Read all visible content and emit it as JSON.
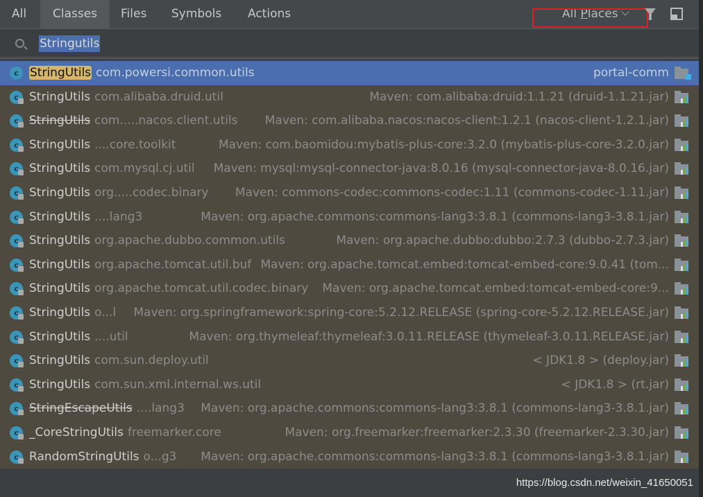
{
  "tabs": [
    {
      "label": "All"
    },
    {
      "label": "Classes",
      "active": true
    },
    {
      "label": "Files"
    },
    {
      "label": "Symbols"
    },
    {
      "label": "Actions"
    }
  ],
  "scope": {
    "label_pre": "All ",
    "label_mnemonic": "P",
    "label_post": "laces"
  },
  "search": {
    "value": "Stringutils"
  },
  "rows": [
    {
      "pre": "",
      "hl": "StringUtils",
      "post": "",
      "pkg": "com.powersi.common.utils",
      "loc": "portal-comm",
      "icon": "module-folder-icon",
      "selected": true
    },
    {
      "pre": "StringUtils",
      "pkg": "com.alibaba.druid.util",
      "loc": "Maven: com.alibaba:druid:1.1.21 (druid-1.1.21.jar)"
    },
    {
      "pre": "StringUtils",
      "pkg": "com.....nacos.client.utils",
      "loc": "Maven: com.alibaba.nacos:nacos-client:1.2.1 (nacos-client-1.2.1.jar)",
      "strike": true
    },
    {
      "pre": "StringUtils",
      "pkg": "....core.toolkit",
      "loc": "Maven: com.baomidou:mybatis-plus-core:3.2.0 (mybatis-plus-core-3.2.0.jar)"
    },
    {
      "pre": "StringUtils",
      "pkg": "com.mysql.cj.util",
      "loc": "Maven: mysql:mysql-connector-java:8.0.16 (mysql-connector-java-8.0.16.jar)"
    },
    {
      "pre": "StringUtils",
      "pkg": "org.....codec.binary",
      "loc": "Maven: commons-codec:commons-codec:1.11 (commons-codec-1.11.jar)"
    },
    {
      "pre": "StringUtils",
      "pkg": "....lang3",
      "loc": "Maven: org.apache.commons:commons-lang3:3.8.1 (commons-lang3-3.8.1.jar)"
    },
    {
      "pre": "StringUtils",
      "pkg": "org.apache.dubbo.common.utils",
      "loc": "Maven: org.apache.dubbo:dubbo:2.7.3 (dubbo-2.7.3.jar)"
    },
    {
      "pre": "StringUtils",
      "pkg": "org.apache.tomcat.util.buf",
      "loc": "Maven: org.apache.tomcat.embed:tomcat-embed-core:9.0.41 (tom..."
    },
    {
      "pre": "StringUtils",
      "pkg": "org.apache.tomcat.util.codec.binary",
      "loc": "Maven: org.apache.tomcat.embed:tomcat-embed-core:9..."
    },
    {
      "pre": "StringUtils",
      "pkg": "o...l",
      "loc": "Maven: org.springframework:spring-core:5.2.12.RELEASE (spring-core-5.2.12.RELEASE.jar)"
    },
    {
      "pre": "StringUtils",
      "pkg": "....util",
      "loc": "Maven: org.thymeleaf:thymeleaf:3.0.11.RELEASE (thymeleaf-3.0.11.RELEASE.jar)"
    },
    {
      "pre": "StringUtils",
      "pkg": "com.sun.deploy.util",
      "loc": "< JDK1.8 > (deploy.jar)"
    },
    {
      "pre": "StringUtils",
      "pkg": "com.sun.xml.internal.ws.util",
      "loc": "< JDK1.8 > (rt.jar)"
    },
    {
      "pre": "StringEscapeUtils",
      "pkg": "....lang3",
      "loc": "Maven: org.apache.commons:commons-lang3:3.8.1 (commons-lang3-3.8.1.jar)",
      "strike": true
    },
    {
      "pre": "_CoreStringUtils",
      "pkg": "freemarker.core",
      "loc": "Maven: org.freemarker:freemarker:2.3.30 (freemarker-2.3.30.jar)"
    },
    {
      "pre": "RandomStringUtils",
      "pkg": "o...g3",
      "loc": "Maven: org.apache.commons:commons-lang3:3.8.1 (commons-lang3-3.8.1.jar)"
    }
  ],
  "watermark": "https://blog.csdn.net/weixin_41650051",
  "colors": {
    "selection": "#4b6eaf",
    "highlight": "#d5b66a",
    "list_bg": "#4e4a3f",
    "red_box": "#e02020"
  }
}
